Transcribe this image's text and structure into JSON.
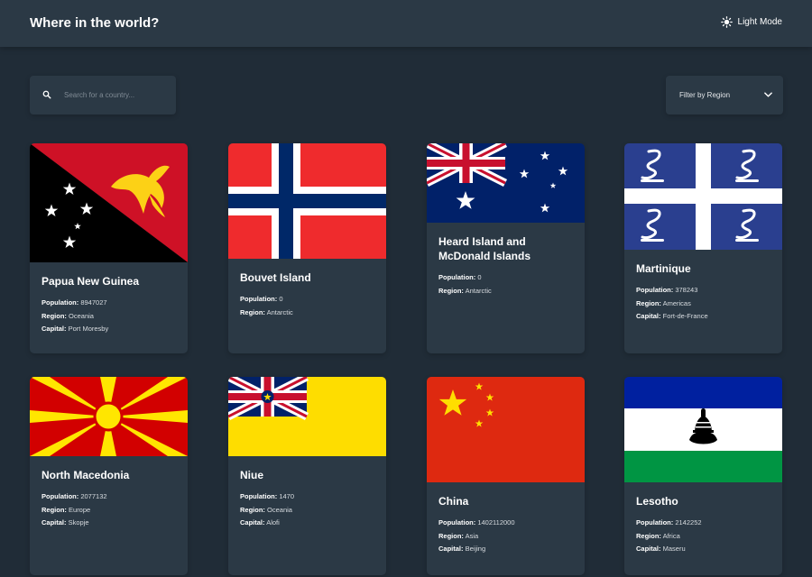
{
  "header": {
    "title": "Where in the world?",
    "theme_label": "Light Mode"
  },
  "search": {
    "placeholder": "Search for a country..."
  },
  "filter": {
    "label": "Filter by Region"
  },
  "labels": {
    "population": "Population:",
    "region": "Region:",
    "capital": "Capital:"
  },
  "countries": [
    {
      "name": "Papua New Guinea",
      "population": "8947027",
      "region": "Oceania",
      "capital": "Port Moresby"
    },
    {
      "name": "Bouvet Island",
      "population": "0",
      "region": "Antarctic"
    },
    {
      "name": "Heard Island and McDonald Islands",
      "population": "0",
      "region": "Antarctic"
    },
    {
      "name": "Martinique",
      "population": "378243",
      "region": "Americas",
      "capital": "Fort-de-France"
    },
    {
      "name": "North Macedonia",
      "population": "2077132",
      "region": "Europe",
      "capital": "Skopje"
    },
    {
      "name": "Niue",
      "population": "1470",
      "region": "Oceania",
      "capital": "Alofi"
    },
    {
      "name": "China",
      "population": "1402112000",
      "region": "Asia",
      "capital": "Beijing"
    },
    {
      "name": "Lesotho",
      "population": "2142252",
      "region": "Africa",
      "capital": "Maseru"
    }
  ],
  "colors": {
    "background": "#202c37",
    "element": "#2b3945",
    "text": "#ffffff"
  }
}
